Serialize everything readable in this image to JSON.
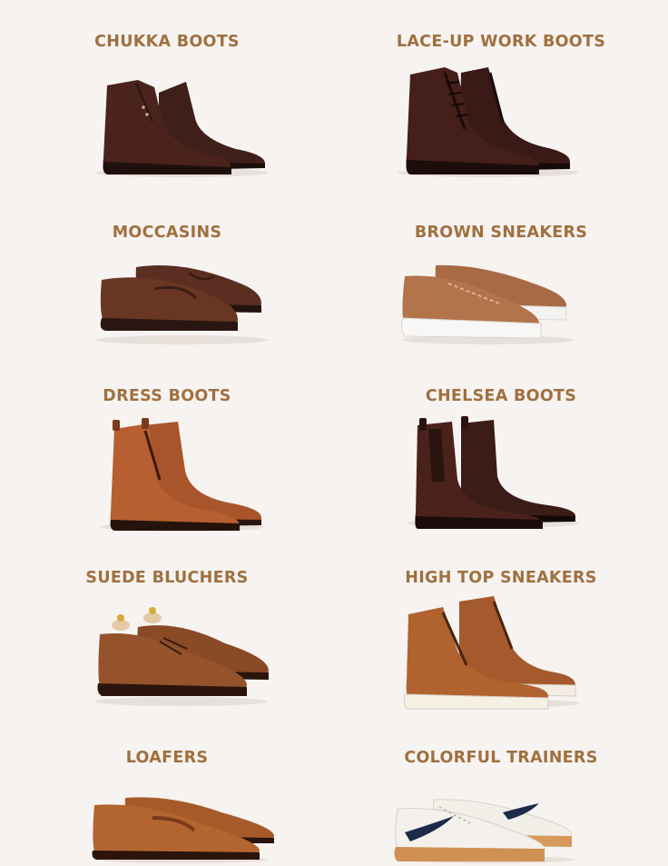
{
  "items": [
    {
      "label": "CHUKKA BOOTS",
      "image": "chukka-boots-image"
    },
    {
      "label": "LACE-UP WORK BOOTS",
      "image": "lace-up-work-boots-image"
    },
    {
      "label": "MOCCASINS",
      "image": "moccasins-image"
    },
    {
      "label": "BROWN SNEAKERS",
      "image": "brown-sneakers-image"
    },
    {
      "label": "DRESS BOOTS",
      "image": "dress-boots-image"
    },
    {
      "label": "CHELSEA BOOTS",
      "image": "chelsea-boots-image"
    },
    {
      "label": "SUEDE BLUCHERS",
      "image": "suede-bluchers-image"
    },
    {
      "label": "HIGH TOP SNEAKERS",
      "image": "high-top-sneakers-image"
    },
    {
      "label": "LOAFERS",
      "image": "loafers-image"
    },
    {
      "label": "COLORFUL TRAINERS",
      "image": "colorful-trainers-image"
    }
  ],
  "colors": {
    "background": "#f6f3f1",
    "label": "#a0703f"
  }
}
